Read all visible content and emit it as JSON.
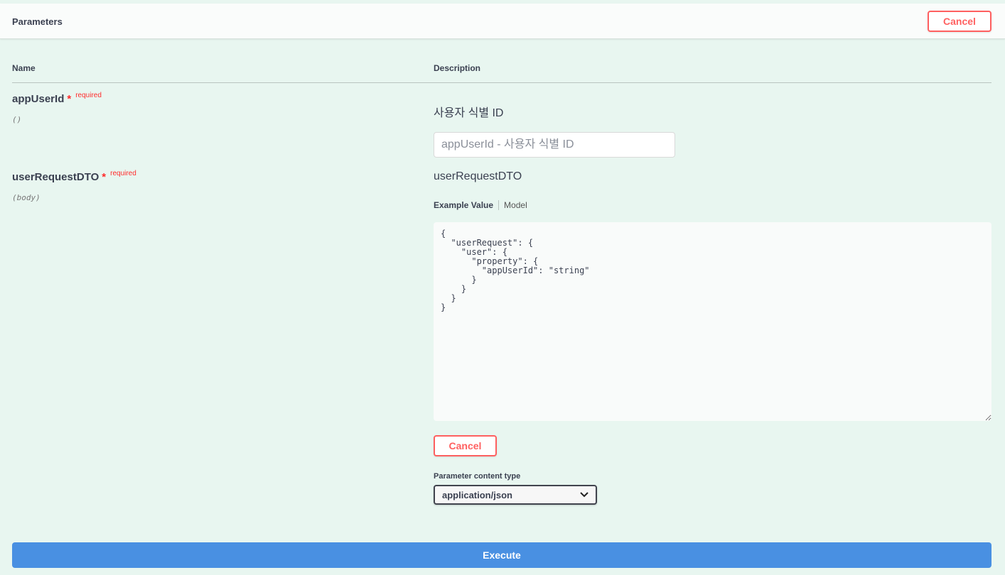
{
  "header": {
    "title": "Parameters",
    "cancel_label": "Cancel"
  },
  "columns": {
    "name": "Name",
    "description": "Description"
  },
  "parameters": [
    {
      "name": "appUserId",
      "required_star": "*",
      "required_label": "required",
      "location": "()",
      "description": "사용자 식별 ID",
      "input_placeholder": "appUserId - 사용자 식별 ID"
    },
    {
      "name": "userRequestDTO",
      "required_star": "*",
      "required_label": "required",
      "location": "(body)",
      "description": "userRequestDTO",
      "tabs": {
        "active": "Example Value",
        "other": "Model"
      },
      "body_value": "{\n  \"userRequest\": {\n    \"user\": {\n      \"property\": {\n        \"appUserId\": \"string\"\n      }\n    }\n  }\n}"
    }
  ],
  "body_cancel_label": "Cancel",
  "content_type": {
    "label": "Parameter content type",
    "selected": "application/json"
  },
  "execute_label": "Execute",
  "icons": {
    "select_arrow": "chevron-down-icon"
  },
  "colors": {
    "accent": "#4990e2",
    "danger": "#ff6060",
    "background": "#e8f6f0"
  }
}
